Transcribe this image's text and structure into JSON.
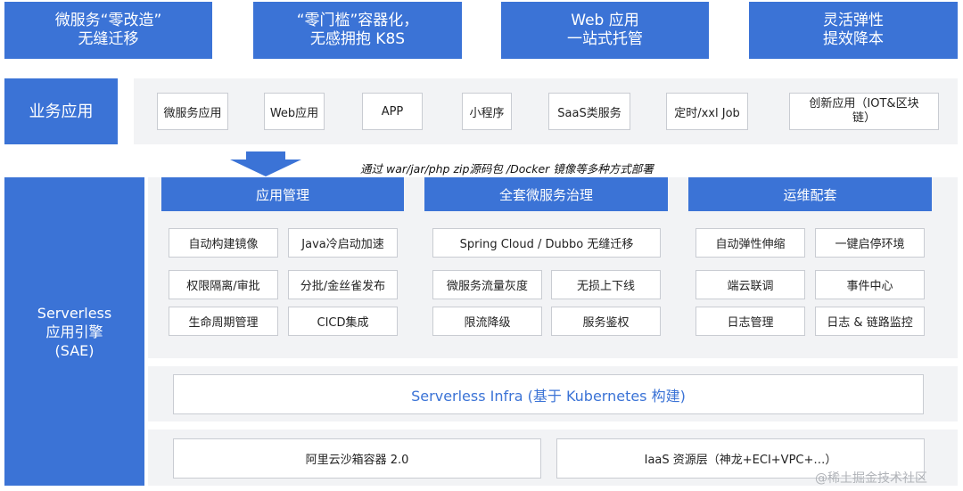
{
  "top_boxes": [
    "微服务“零改造”\n无缝迁移",
    "“零门槛”容器化，\n无感拥抱 K8S",
    "Web 应用\n一站式托管",
    "灵活弹性\n提效降本"
  ],
  "business": {
    "label": "业务应用",
    "items": [
      "微服务应用",
      "Web应用",
      "APP",
      "小程序",
      "SaaS类服务",
      "定时/xxl Job",
      "创新应用（IOT&区块\n链）"
    ]
  },
  "deploy_caption": "通过 war/jar/php zip源码包 /Docker 镜像等多种方式部署",
  "engine_label": "Serverless\n应用引擎\n(SAE)",
  "columns": [
    {
      "title": "应用管理",
      "items": [
        "自动构建镜像",
        "Java冷启动加速",
        "权限隔离/审批",
        "分批/金丝雀发布",
        "生命周期管理",
        "CICD集成"
      ]
    },
    {
      "title": "全套微服务治理",
      "items": [
        "Spring Cloud / Dubbo 无缝迁移",
        "微服务流量灰度",
        "无损上下线",
        "限流降级",
        "服务鉴权"
      ]
    },
    {
      "title": "运维配套",
      "items": [
        "自动弹性伸缩",
        "一键启停环境",
        "端云联调",
        "事件中心",
        "日志管理",
        "日志 & 链路监控"
      ]
    }
  ],
  "infra": "Serverless Infra (基于 Kubernetes 构建)",
  "bottom": [
    "阿里云沙箱容器 2.0",
    "IaaS 资源层（神龙+ECI+VPC+…）"
  ],
  "watermark": "@稀土掘金技术社区",
  "colors": {
    "accent": "#3b73d6",
    "panel": "#f2f3f5"
  }
}
